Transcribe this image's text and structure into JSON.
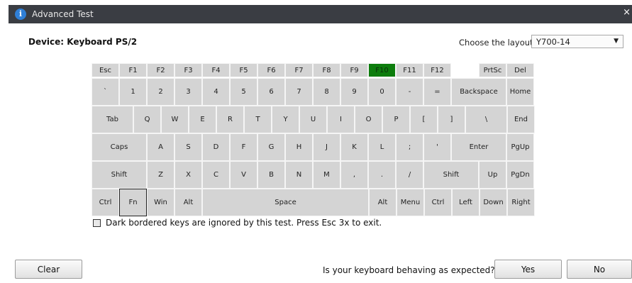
{
  "window": {
    "title": "Advanced Test",
    "info_icon": "info-icon",
    "close_label": "×"
  },
  "device_label": "Device: Keyboard PS/2",
  "layout": {
    "label": "Choose the layout",
    "value": "Y700-14"
  },
  "keyboard": {
    "rows": [
      [
        {
          "label": "Esc"
        },
        {
          "label": "F1"
        },
        {
          "label": "F2"
        },
        {
          "label": "F3"
        },
        {
          "label": "F4"
        },
        {
          "label": "F5"
        },
        {
          "label": "F6"
        },
        {
          "label": "F7"
        },
        {
          "label": "F8"
        },
        {
          "label": "F9"
        },
        {
          "label": "F10",
          "state": "lit"
        },
        {
          "label": "F11"
        },
        {
          "label": "F12"
        },
        {
          "label": ""
        },
        {
          "label": "PrtSc"
        },
        {
          "label": "Del"
        }
      ],
      [
        {
          "label": "`"
        },
        {
          "label": "1"
        },
        {
          "label": "2"
        },
        {
          "label": "3"
        },
        {
          "label": "4"
        },
        {
          "label": "5"
        },
        {
          "label": "6"
        },
        {
          "label": "7"
        },
        {
          "label": "8"
        },
        {
          "label": "9"
        },
        {
          "label": "0"
        },
        {
          "label": "-"
        },
        {
          "label": "="
        },
        {
          "label": "Backspace"
        },
        {
          "label": "Home"
        }
      ],
      [
        {
          "label": "Tab"
        },
        {
          "label": "Q"
        },
        {
          "label": "W"
        },
        {
          "label": "E"
        },
        {
          "label": "R"
        },
        {
          "label": "T"
        },
        {
          "label": "Y"
        },
        {
          "label": "U"
        },
        {
          "label": "I"
        },
        {
          "label": "O"
        },
        {
          "label": "P"
        },
        {
          "label": "["
        },
        {
          "label": "]"
        },
        {
          "label": "\\"
        },
        {
          "label": "End"
        }
      ],
      [
        {
          "label": "Caps"
        },
        {
          "label": "A"
        },
        {
          "label": "S"
        },
        {
          "label": "D"
        },
        {
          "label": "F"
        },
        {
          "label": "G"
        },
        {
          "label": "H"
        },
        {
          "label": "J"
        },
        {
          "label": "K"
        },
        {
          "label": "L"
        },
        {
          "label": ";"
        },
        {
          "label": "'"
        },
        {
          "label": "Enter"
        },
        {
          "label": "PgUp"
        }
      ],
      [
        {
          "label": "Shift"
        },
        {
          "label": "Z"
        },
        {
          "label": "X"
        },
        {
          "label": "C"
        },
        {
          "label": "V"
        },
        {
          "label": "B"
        },
        {
          "label": "N"
        },
        {
          "label": "M"
        },
        {
          "label": ","
        },
        {
          "label": "."
        },
        {
          "label": "/"
        },
        {
          "label": "Shift"
        },
        {
          "label": "Up"
        },
        {
          "label": "PgDn"
        }
      ],
      [
        {
          "label": "Ctrl"
        },
        {
          "label": "Fn",
          "state": "dark"
        },
        {
          "label": "Win"
        },
        {
          "label": "Alt"
        },
        {
          "label": "Space"
        },
        {
          "label": "Alt"
        },
        {
          "label": "Menu"
        },
        {
          "label": "Ctrl"
        },
        {
          "label": "Left"
        },
        {
          "label": "Down"
        },
        {
          "label": "Right"
        }
      ]
    ],
    "colors": {
      "key": "#d4d4d4",
      "lit": "#0d7d0d",
      "dark_border": "#222222"
    }
  },
  "note": "Dark bordered keys are ignored by this test. Press Esc 3x to exit.",
  "buttons": {
    "clear": "Clear",
    "yes": "Yes",
    "no": "No"
  },
  "question": "Is your keyboard behaving as expected?"
}
